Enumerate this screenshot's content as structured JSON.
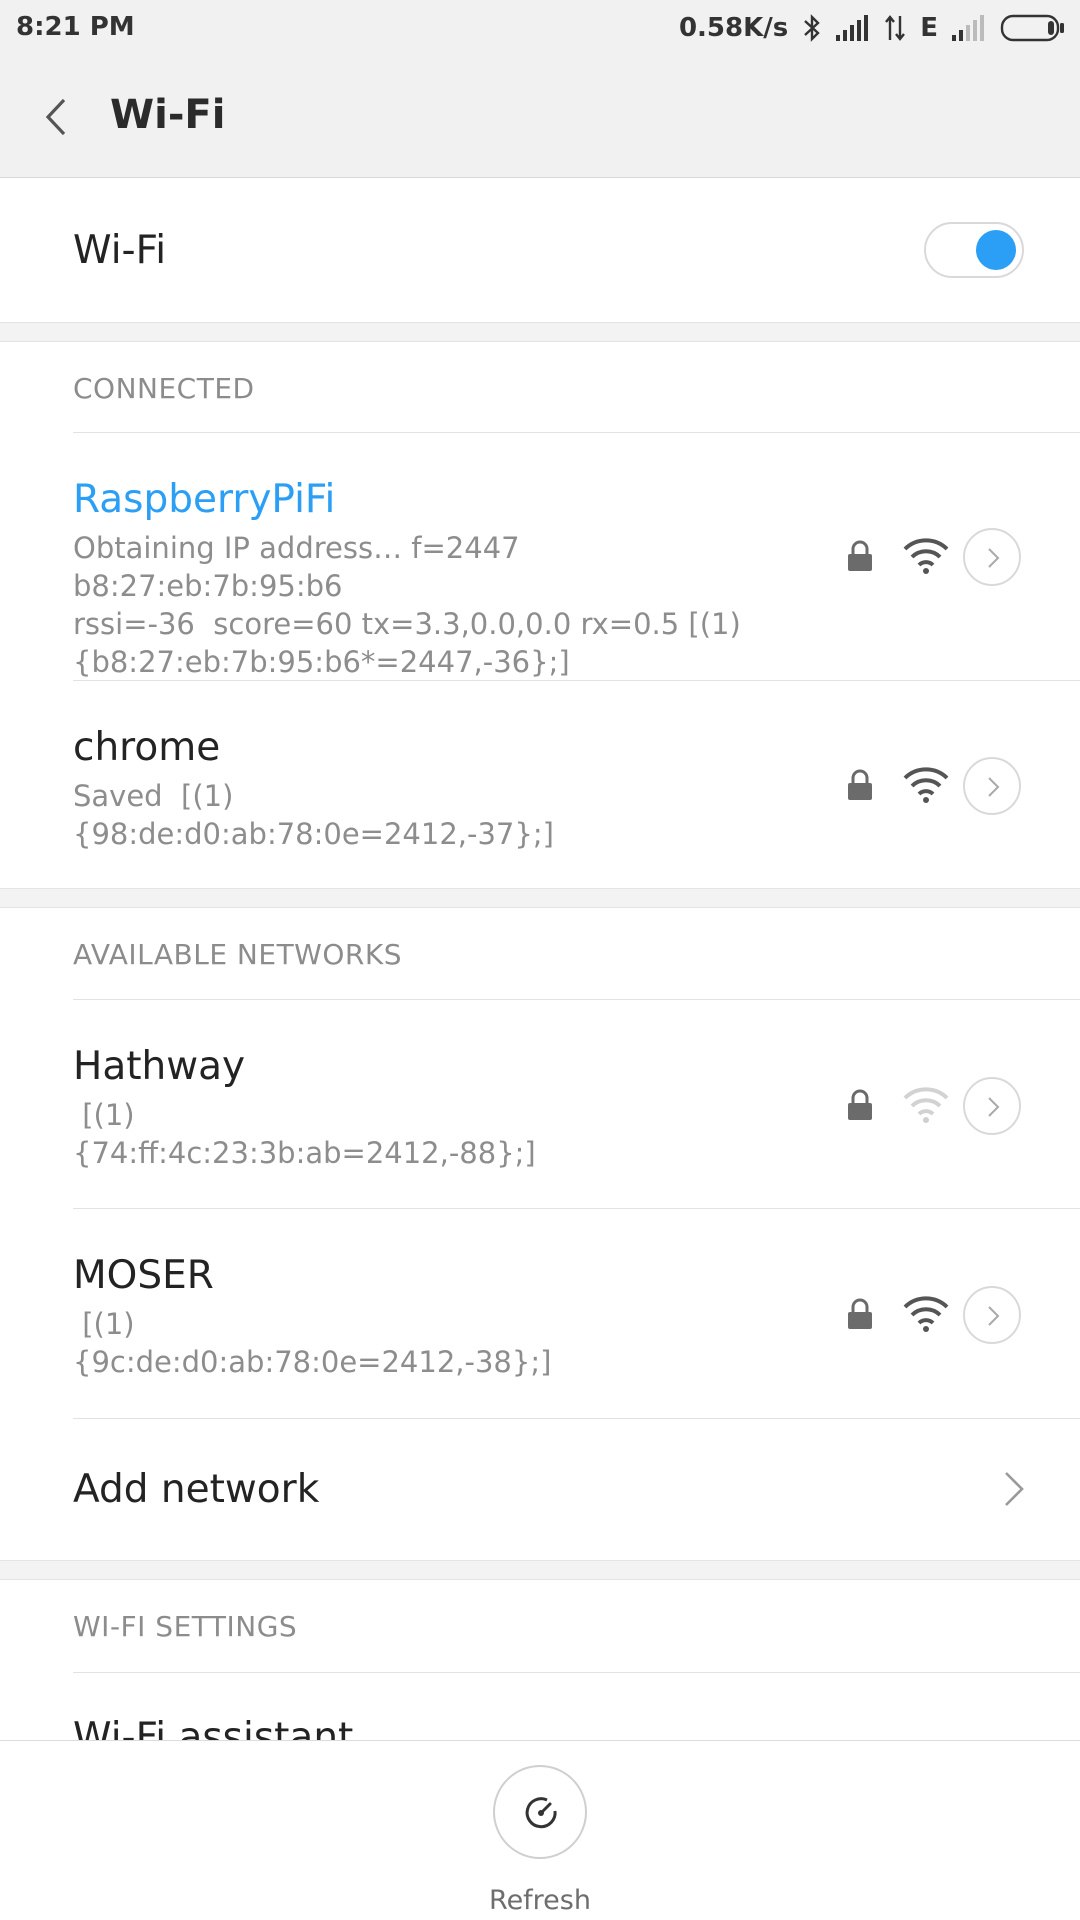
{
  "status_bar": {
    "time": "8:21 PM",
    "net_speed": "0.58K/s",
    "network_type": "E",
    "icons": [
      "bluetooth-icon",
      "signal-icon",
      "data-arrows-icon",
      "signal-weak-icon",
      "battery-icon"
    ]
  },
  "header": {
    "title": "Wi-Fi",
    "back_icon": "chevron-left-icon"
  },
  "wifi_toggle": {
    "label": "Wi-Fi",
    "enabled": true,
    "accent": "#2a9ff5"
  },
  "connected": {
    "header": "CONNECTED",
    "networks": [
      {
        "name": "RaspberryPiFi",
        "detail": "Obtaining IP address… f=2447  b8:27:eb:7b:95:b6\nrssi=-36  score=60 tx=3.3,0.0,0.0 rx=0.5 [(1)\n{b8:27:eb:7b:95:b6*=2447,-36};]",
        "secured": true,
        "signal": "strong"
      },
      {
        "name": "chrome",
        "detail": "Saved  [(1)\n{98:de:d0:ab:78:0e=2412,-37};]",
        "secured": true,
        "signal": "strong"
      }
    ]
  },
  "available": {
    "header": "AVAILABLE NETWORKS",
    "networks": [
      {
        "name": "Hathway",
        "detail": " [(1)\n{74:ff:4c:23:3b:ab=2412,-88};]",
        "secured": true,
        "signal": "weak"
      },
      {
        "name": "MOSER",
        "detail": " [(1)\n{9c:de:d0:ab:78:0e=2412,-38};]",
        "secured": true,
        "signal": "strong"
      }
    ],
    "add_network": "Add network"
  },
  "wifi_settings": {
    "header": "WI-FI SETTINGS",
    "first_item": "Wi-Fi assistant"
  },
  "bottom_bar": {
    "refresh_label": "Refresh"
  }
}
